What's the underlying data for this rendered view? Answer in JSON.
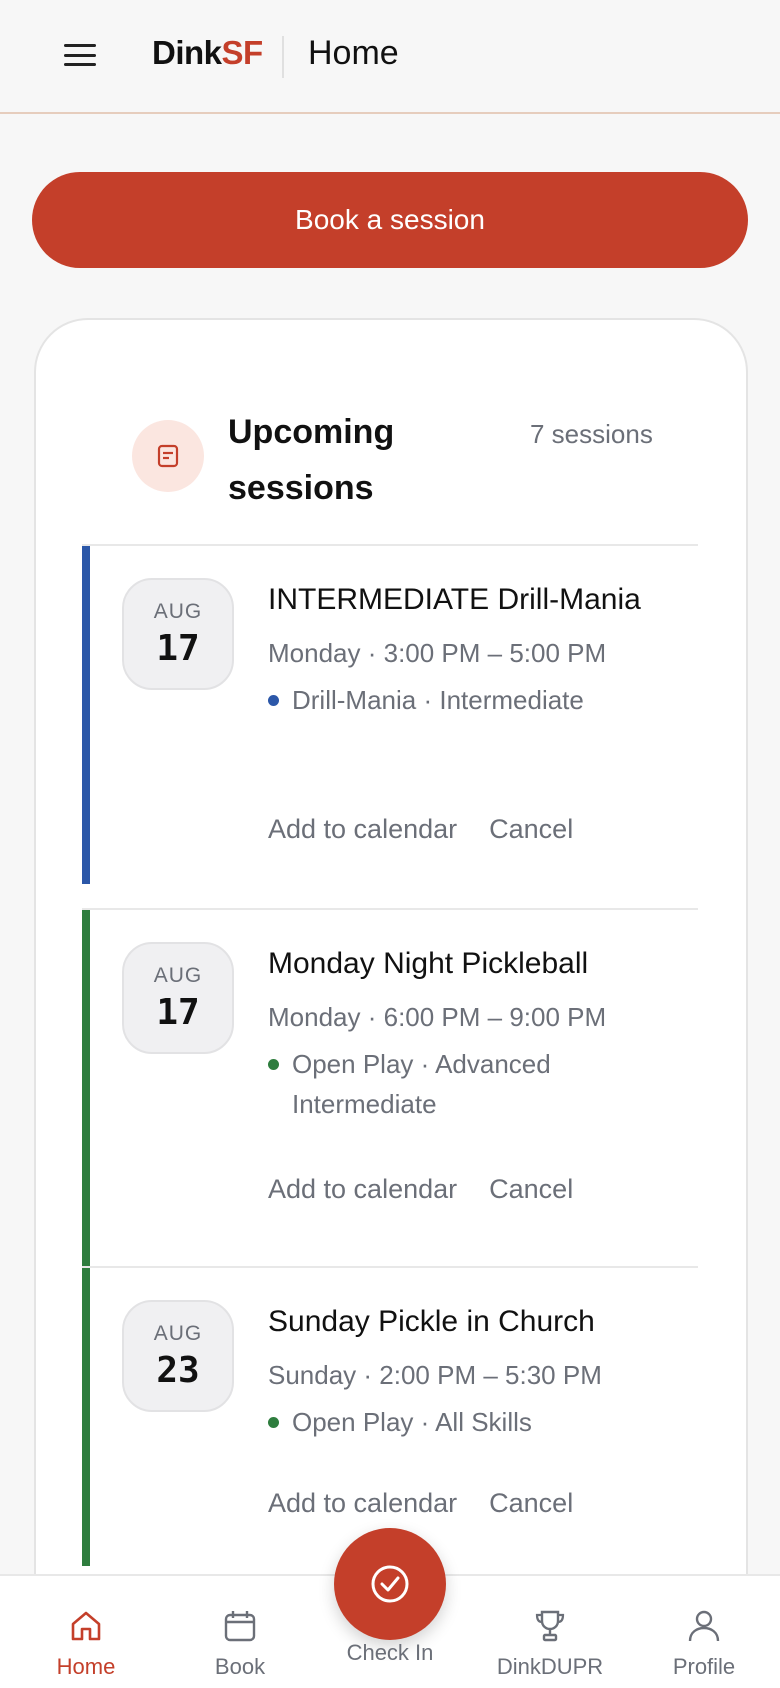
{
  "header": {
    "logo_part1": "Dink",
    "logo_part2": "SF",
    "title": "Home"
  },
  "book_button": "Book a session",
  "upcoming": {
    "title": "Upcoming sessions",
    "count": "7 sessions",
    "sessions": [
      {
        "month": "AUG",
        "day": "17",
        "title": "INTERMEDIATE Drill-Mania",
        "time": "Monday · 3:00 PM – 5:00 PM",
        "tag": "Drill-Mania · Intermediate",
        "color": "#2b57a8",
        "add_calendar": "Add to calendar",
        "cancel": "Cancel"
      },
      {
        "month": "AUG",
        "day": "17",
        "title": "Monday Night Pickleball",
        "time": "Monday · 6:00 PM – 9:00 PM",
        "tag": "Open Play · Advanced Intermediate",
        "color": "#2e7d3e",
        "add_calendar": "Add to calendar",
        "cancel": "Cancel"
      },
      {
        "month": "AUG",
        "day": "23",
        "title": "Sunday Pickle in Church",
        "time": "Sunday · 2:00 PM – 5:30 PM",
        "tag": "Open Play · All Skills",
        "color": "#2e7d3e",
        "add_calendar": "Add to calendar",
        "cancel": "Cancel"
      }
    ]
  },
  "nav": {
    "home": "Home",
    "book": "Book",
    "checkin": "Check In",
    "dinkdupr": "DinkDUPR",
    "profile": "Profile"
  },
  "colors": {
    "accent": "#c43f2a",
    "muted": "#6b6f78"
  }
}
